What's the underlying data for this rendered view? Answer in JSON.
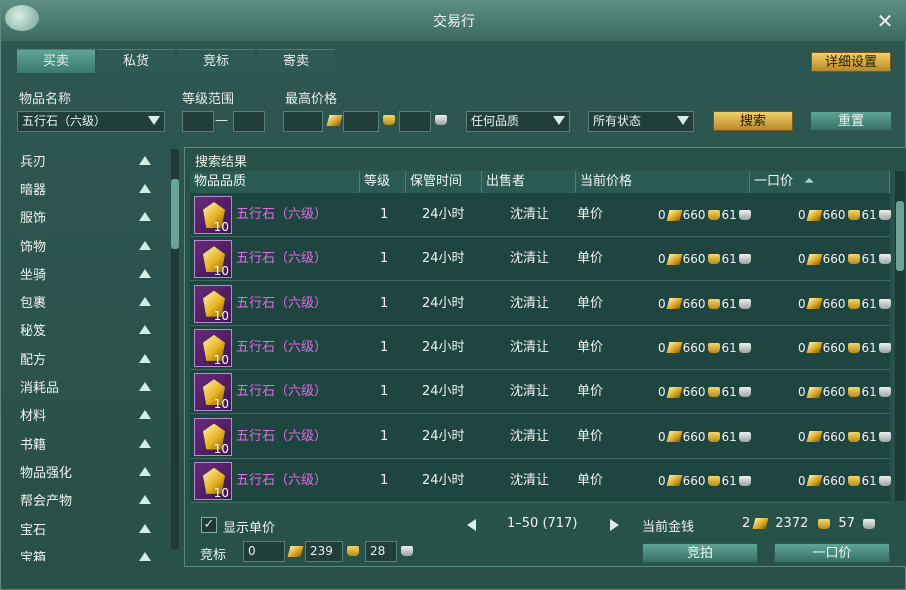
{
  "window": {
    "title": "交易行"
  },
  "tabs": [
    "买卖",
    "私货",
    "竞标",
    "寄卖"
  ],
  "detail_settings_label": "详细设置",
  "filters": {
    "item_name_label": "物品名称",
    "item_name_value": "五行石（六级）",
    "level_range_label": "等级范围",
    "level_sep": "—",
    "max_price_label": "最高价格",
    "quality_value": "任何品质",
    "status_value": "所有状态",
    "search_label": "搜索",
    "reset_label": "重置"
  },
  "categories": [
    "兵刃",
    "暗器",
    "服饰",
    "饰物",
    "坐骑",
    "包裹",
    "秘笈",
    "配方",
    "消耗品",
    "材料",
    "书籍",
    "物品强化",
    "帮会产物",
    "宝石",
    "宝箱"
  ],
  "results": {
    "title": "搜索结果",
    "columns": [
      "物品品质",
      "等级",
      "保管时间",
      "出售者",
      "当前价格",
      "一口价"
    ],
    "rows": [
      {
        "name": "五行石（六级）",
        "qty": "10",
        "level": "1",
        "time": "24小时",
        "seller": "沈清让",
        "price_type": "单价",
        "cur": {
          "a": "0",
          "b": "660",
          "c": "61"
        },
        "buyout": {
          "a": "0",
          "b": "660",
          "c": "61"
        }
      },
      {
        "name": "五行石（六级）",
        "qty": "10",
        "level": "1",
        "time": "24小时",
        "seller": "沈清让",
        "price_type": "单价",
        "cur": {
          "a": "0",
          "b": "660",
          "c": "61"
        },
        "buyout": {
          "a": "0",
          "b": "660",
          "c": "61"
        }
      },
      {
        "name": "五行石（六级）",
        "qty": "10",
        "level": "1",
        "time": "24小时",
        "seller": "沈清让",
        "price_type": "单价",
        "cur": {
          "a": "0",
          "b": "660",
          "c": "61"
        },
        "buyout": {
          "a": "0",
          "b": "660",
          "c": "61"
        }
      },
      {
        "name": "五行石（六级）",
        "qty": "10",
        "level": "1",
        "time": "24小时",
        "seller": "沈清让",
        "price_type": "单价",
        "cur": {
          "a": "0",
          "b": "660",
          "c": "61"
        },
        "buyout": {
          "a": "0",
          "b": "660",
          "c": "61"
        }
      },
      {
        "name": "五行石（六级）",
        "qty": "10",
        "level": "1",
        "time": "24小时",
        "seller": "沈清让",
        "price_type": "单价",
        "cur": {
          "a": "0",
          "b": "660",
          "c": "61"
        },
        "buyout": {
          "a": "0",
          "b": "660",
          "c": "61"
        }
      },
      {
        "name": "五行石（六级）",
        "qty": "10",
        "level": "1",
        "time": "24小时",
        "seller": "沈清让",
        "price_type": "单价",
        "cur": {
          "a": "0",
          "b": "660",
          "c": "61"
        },
        "buyout": {
          "a": "0",
          "b": "660",
          "c": "61"
        }
      },
      {
        "name": "五行石（六级）",
        "qty": "10",
        "level": "1",
        "time": "24小时",
        "seller": "沈清让",
        "price_type": "单价",
        "cur": {
          "a": "0",
          "b": "660",
          "c": "61"
        },
        "buyout": {
          "a": "0",
          "b": "660",
          "c": "61"
        }
      }
    ]
  },
  "footer": {
    "show_unit_price_label": "显示单价",
    "show_unit_price_checked": true,
    "pagination": "1–50 (717)",
    "current_money_label": "当前金钱",
    "money": {
      "a": "2",
      "b": "2372",
      "c": "57"
    },
    "bid_label": "竞标",
    "bid": {
      "a": "0",
      "b": "239",
      "c": "28"
    },
    "bid_button": "竞拍",
    "buyout_button": "一口价"
  }
}
